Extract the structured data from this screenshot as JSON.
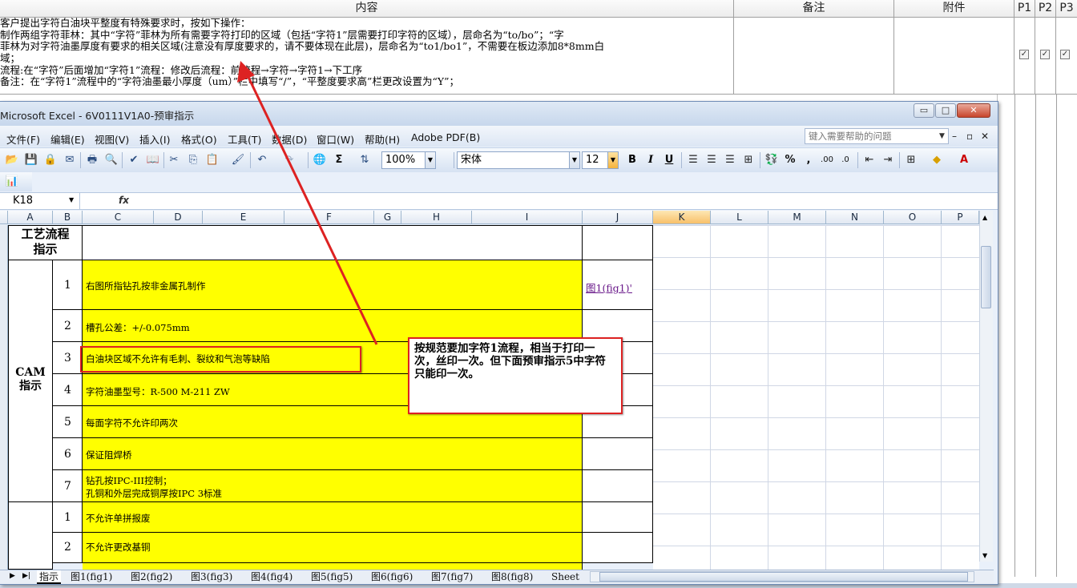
{
  "background": {
    "headers": [
      "内容",
      "备注",
      "附件",
      "P1",
      "P2",
      "P3"
    ],
    "content_lines": [
      "客户提出字符白油块平整度有特殊要求时，按如下操作：",
      "制作两组字符菲林：其中“字符”菲林为所有需要字符打印的区域（包括“字符1”层需要打印字符的区域），层命名为“to/bo”；“字",
      "菲林为对字符油墨厚度有要求的相关区域(注意没有厚度要求的，请不要体现在此层)，层命名为“to1/bo1”，不需要在板边添加8*8mm白",
      "域；",
      "流程:在“字符”后面增加“字符1”流程：修改后流程：前流程→字符→字符1→下工序",
      "备注：在“字符1”流程中的“字符油墨最小厚度（um）”栏中填写“/”，“平整度要求高”栏更改设置为“Y”；"
    ],
    "checks": [
      "✓",
      "✓",
      "✓"
    ]
  },
  "excel": {
    "title": "Microsoft Excel - 6V0111V1A0-预审指示",
    "window_buttons": [
      "▭",
      "□",
      "✕"
    ],
    "menu": [
      "文件(F)",
      "编辑(E)",
      "视图(V)",
      "插入(I)",
      "格式(O)",
      "工具(T)",
      "数据(D)",
      "窗口(W)",
      "帮助(H)",
      "Adobe PDF(B)"
    ],
    "help_placeholder": "键入需要帮助的问题",
    "mdi_buttons": [
      "–",
      "▫",
      "✕"
    ],
    "zoom": "100%",
    "font_name": "宋体",
    "font_size": "12",
    "format_buttons": [
      "B",
      "I",
      "U"
    ],
    "name_box": "K18",
    "fx": "fx",
    "columns": [
      "A",
      "B",
      "C",
      "D",
      "E",
      "F",
      "G",
      "H",
      "I",
      "J",
      "K",
      "L",
      "M",
      "N",
      "O",
      "P"
    ],
    "header_cell": "工艺流程\n指示",
    "section": "CAM\n指示",
    "rows": [
      {
        "num": "1",
        "text": "右图所指钻孔按非金属孔制作",
        "link": "图1(fig1)'"
      },
      {
        "num": "2",
        "text": "槽孔公差：+/-0.075mm"
      },
      {
        "num": "3",
        "text": "白油块区域不允许有毛刺、裂纹和气泡等缺陷"
      },
      {
        "num": "4",
        "text": "字符油墨型号：R-500 M-211 ZW"
      },
      {
        "num": "5",
        "text": "每面字符不允许印两次"
      },
      {
        "num": "6",
        "text": "保证阻焊桥"
      },
      {
        "num": "7",
        "text": "钻孔按IPC-III控制；",
        "text2": "孔铜和外层完成铜厚按IPC 3标准"
      },
      {
        "num": "1",
        "text": "不允许单拼报废"
      },
      {
        "num": "2",
        "text": "不允许更改基铜"
      }
    ],
    "sheet_tabs": [
      "指示",
      "图1(fig1)",
      "图2(fig2)",
      "图3(fig3)",
      "图4(fig4)",
      "图5(fig5)",
      "图6(fig6)",
      "图7(fig7)",
      "图8(fig8)",
      "Sheet"
    ]
  },
  "callout": "按规范要加字符1流程，相当于打印一次，丝印一次。但下面预审指示5中字符只能印一次。",
  "colors": {
    "yellow": "#ffff00",
    "annotation_red": "#dd2222",
    "selected_col": "#f8c06a"
  }
}
